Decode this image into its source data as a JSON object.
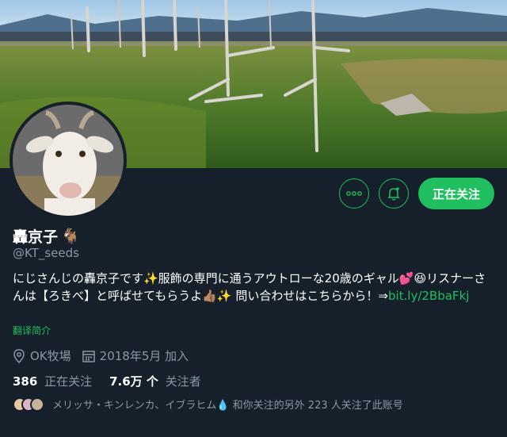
{
  "profile": {
    "name": "轟京子",
    "name_emoji": "🐐",
    "handle": "@KT_seeds",
    "bio_text": "にじさんじの轟京子です✨服飾の専門に通うアウトローな20歳のギャル💕😆リスナーさんは【ろきべ】と呼ばせてもらうよ👍🏽✨ 問い合わせはこちらから！⇒",
    "bio_link": "bit.ly/2BbaFkj",
    "translate_label": "翻译简介",
    "location": "OK牧場",
    "joined": "2018年5月 加入",
    "following_count": "386",
    "following_label": "正在关注",
    "followers_count": "7.6万 个",
    "followers_label": "关注者",
    "followed_by": "メリッサ・キンレンカ、イブラヒム💧 和你关注的另外 223 人关注了此账号"
  },
  "actions": {
    "more_icon": "more-icon",
    "notify_icon": "bell-add-icon",
    "follow_label": "正在关注"
  },
  "colors": {
    "background": "#15202b",
    "accent": "#1fbf5f",
    "muted": "#8899a6"
  }
}
